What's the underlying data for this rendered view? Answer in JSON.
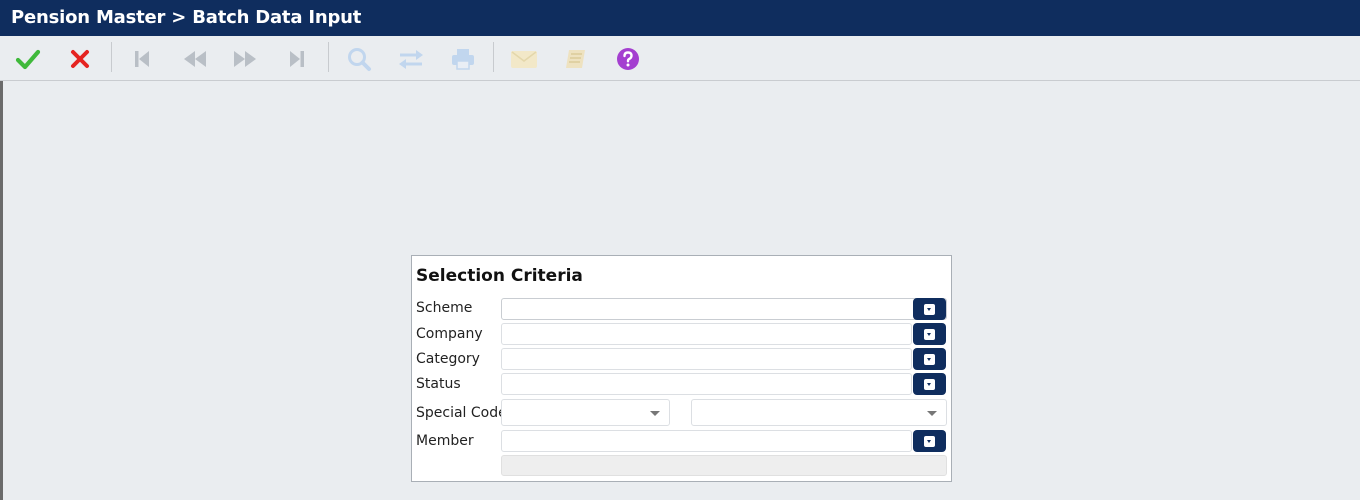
{
  "header": {
    "title": "Pension Master > Batch Data Input"
  },
  "toolbar": {
    "buttons": [
      {
        "icon": "check-icon",
        "color": "#3fb93b"
      },
      {
        "icon": "close-icon",
        "color": "#e52421"
      },
      {
        "icon": "first-record-icon",
        "color": "#b9bfc6"
      },
      {
        "icon": "previous-record-icon",
        "color": "#b9bfc6"
      },
      {
        "icon": "next-record-icon",
        "color": "#b9bfc6"
      },
      {
        "icon": "last-record-icon",
        "color": "#b9bfc6"
      },
      {
        "icon": "search-icon",
        "color": "#c1d6ee"
      },
      {
        "icon": "transfer-icon",
        "color": "#c1d6ee"
      },
      {
        "icon": "print-icon",
        "color": "#c1d6ee"
      },
      {
        "icon": "mail-icon",
        "color": "#f2e8c8"
      },
      {
        "icon": "notebook-icon",
        "color": "#eee2c0"
      },
      {
        "icon": "help-icon",
        "color": "#a43fd0"
      }
    ]
  },
  "selection": {
    "title": "Selection Criteria",
    "fields": {
      "scheme": {
        "label": "Scheme",
        "value": ""
      },
      "company": {
        "label": "Company",
        "value": ""
      },
      "category": {
        "label": "Category",
        "value": ""
      },
      "status": {
        "label": "Status",
        "value": ""
      },
      "special_code": {
        "label": "Special Code",
        "value1": "",
        "value2": ""
      },
      "member": {
        "label": "Member",
        "value": "",
        "name": ""
      }
    }
  },
  "colors": {
    "brand": "#0f2d5e",
    "background": "#eaedf0"
  }
}
